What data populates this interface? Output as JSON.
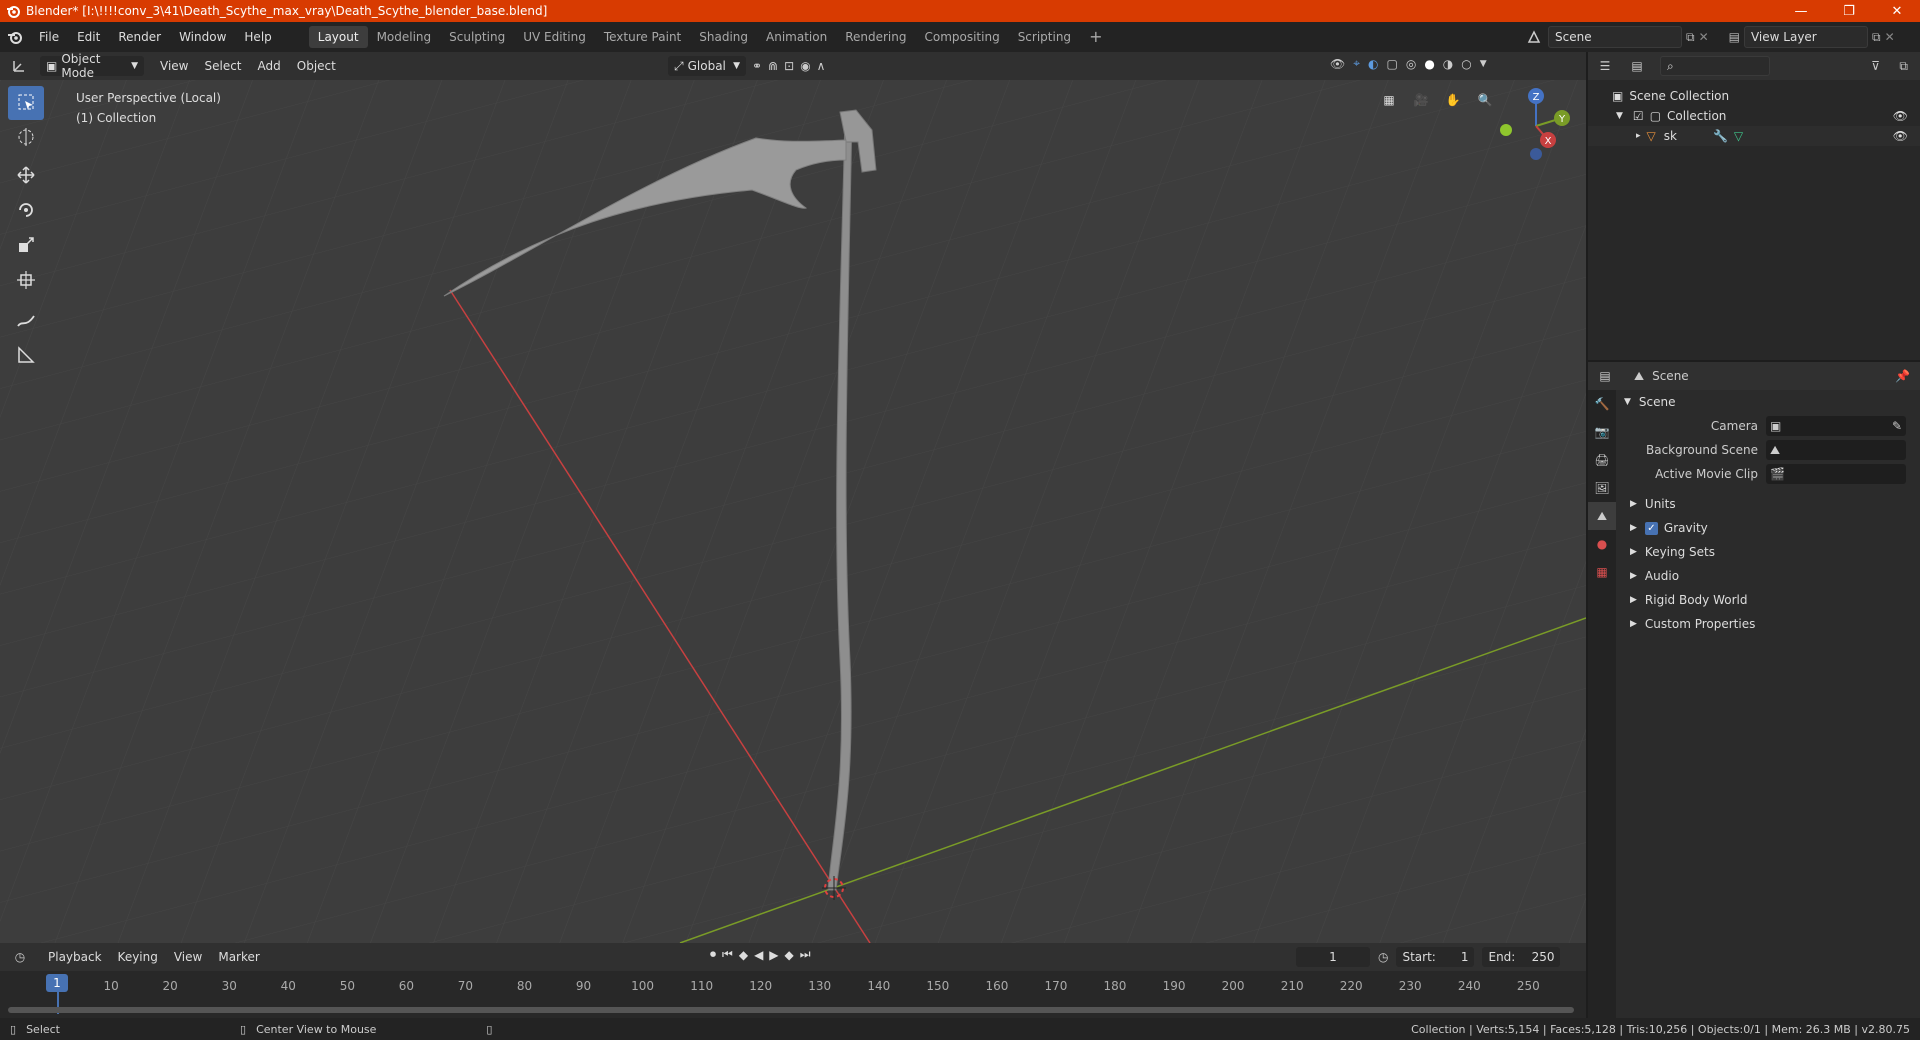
{
  "titlebar": {
    "title": "Blender* [I:\\!!!!conv_3\\41\\Death_Scythe_max_vray\\Death_Scythe_blender_base.blend]",
    "minimize": "—",
    "maximize": "❐",
    "close": "✕"
  },
  "menubar": {
    "items": [
      "File",
      "Edit",
      "Render",
      "Window",
      "Help"
    ],
    "workspaces": [
      "Layout",
      "Modeling",
      "Sculpting",
      "UV Editing",
      "Texture Paint",
      "Shading",
      "Animation",
      "Rendering",
      "Compositing",
      "Scripting"
    ],
    "add_workspace": "+",
    "scene_name": "Scene",
    "view_layer": "View Layer"
  },
  "viewport_header": {
    "mode": "Object Mode",
    "menus": [
      "View",
      "Select",
      "Add",
      "Object"
    ],
    "orientation": "Global"
  },
  "viewport": {
    "perspective": "User Perspective (Local)",
    "collection": "(1) Collection",
    "gizmo": {
      "z": "Z",
      "y": "Y",
      "x": "X"
    }
  },
  "timeline": {
    "menus": [
      "Playback",
      "Keying",
      "View",
      "Marker"
    ],
    "current_frame": "1",
    "start_label": "Start:",
    "start": "1",
    "end_label": "End:",
    "end": "250",
    "ticks": [
      "1",
      "10",
      "20",
      "30",
      "40",
      "50",
      "60",
      "70",
      "80",
      "90",
      "100",
      "110",
      "120",
      "130",
      "140",
      "150",
      "160",
      "170",
      "180",
      "190",
      "200",
      "210",
      "220",
      "230",
      "240",
      "250"
    ]
  },
  "statusbar": {
    "select": "Select",
    "center_view": "Center View to Mouse",
    "stats": "Collection | Verts:5,154 | Faces:5,128 | Tris:10,256 | Objects:0/1 | Mem: 26.3 MB | v2.80.75"
  },
  "outliner": {
    "scene_collection": "Scene Collection",
    "collection": "Collection",
    "object": "sk"
  },
  "properties": {
    "header": "Scene",
    "section": "Scene",
    "camera_label": "Camera",
    "background_label": "Background Scene",
    "movieclip_label": "Active Movie Clip",
    "panels": [
      "Units",
      "Gravity",
      "Keying Sets",
      "Audio",
      "Rigid Body World",
      "Custom Properties"
    ]
  },
  "colors": {
    "titlebar": "#d83b01",
    "active_tool": "#4772b3",
    "x_axis": "#c74040",
    "y_axis": "#7a9c27",
    "z_axis": "#4472c4"
  }
}
